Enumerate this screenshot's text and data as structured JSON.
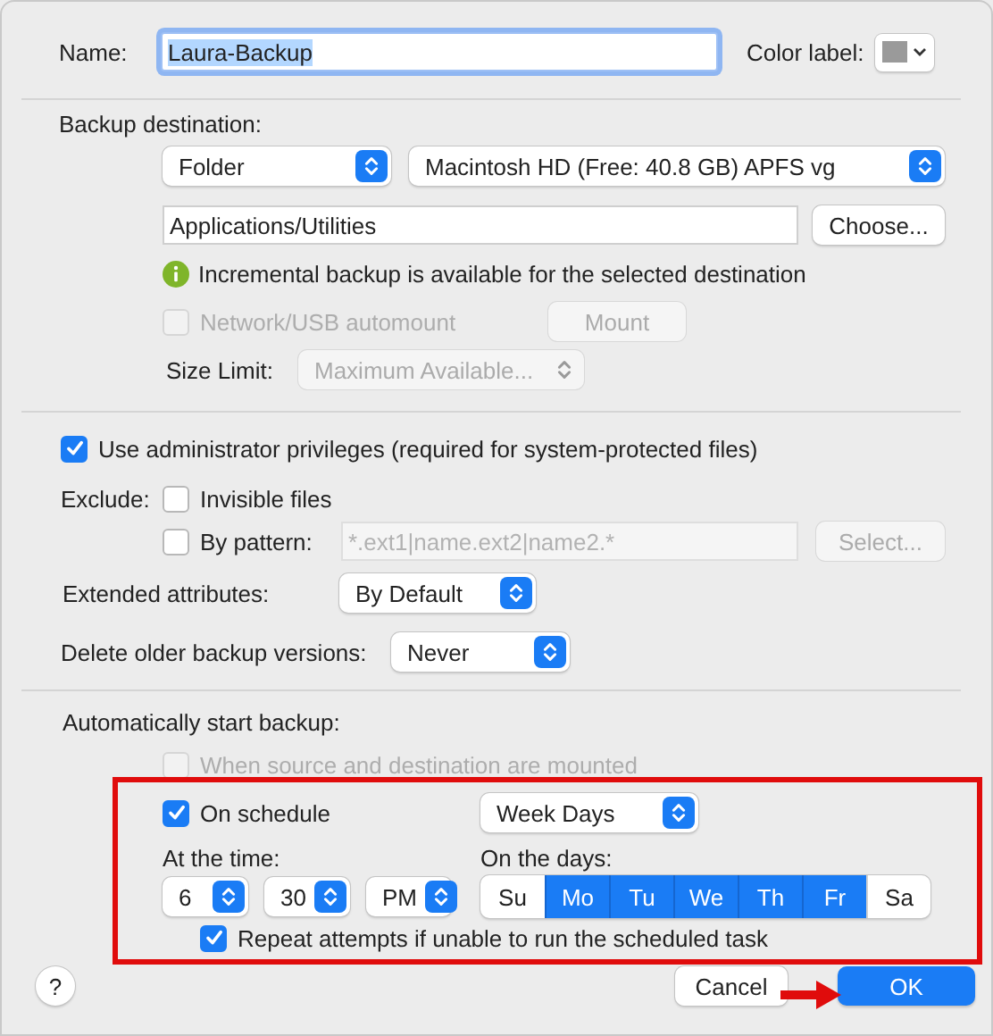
{
  "name_field": {
    "label": "Name:",
    "value": "Laura-Backup",
    "selected": true
  },
  "color_label": {
    "label": "Color label:"
  },
  "backup_destination": {
    "heading": "Backup destination:",
    "type_popup": {
      "value": "Folder"
    },
    "volume_popup": {
      "value": "Macintosh HD (Free: 40.8 GB) APFS vg"
    },
    "path_field": {
      "value": "Applications/Utilities"
    },
    "choose_button": {
      "label": "Choose..."
    },
    "info": "Incremental backup is available for the selected destination",
    "automount": {
      "label": "Network/USB automount",
      "checked": false,
      "disabled": true
    },
    "mount_button": {
      "label": "Mount",
      "disabled": true
    },
    "size_limit": {
      "label": "Size Limit:",
      "value": "Maximum Available...",
      "disabled": true
    }
  },
  "admin_privileges": {
    "label": "Use administrator privileges (required for system-protected files)",
    "checked": true
  },
  "exclude": {
    "label": "Exclude:",
    "invisible_files": {
      "label": "Invisible files",
      "checked": false
    },
    "by_pattern": {
      "label": "By pattern:",
      "checked": false
    },
    "pattern_field": {
      "placeholder": "*.ext1|name.ext2|name2.*",
      "disabled": true
    },
    "select_button": {
      "label": "Select...",
      "disabled": true
    }
  },
  "extended_attributes": {
    "label": "Extended attributes:",
    "value": "By Default"
  },
  "delete_older": {
    "label": "Delete older backup versions:",
    "value": "Never"
  },
  "auto_start": {
    "heading": "Automatically start backup:",
    "when_mounted": {
      "label": "When source and destination are mounted",
      "checked": false,
      "disabled": true
    },
    "on_schedule": {
      "label": "On schedule",
      "checked": true
    },
    "frequency": {
      "value": "Week Days"
    },
    "time": {
      "label": "At the time:",
      "hour": "6",
      "minute": "30",
      "period": "PM"
    },
    "days": {
      "label": "On the days:",
      "items": [
        {
          "label": "Su",
          "selected": false
        },
        {
          "label": "Mo",
          "selected": true
        },
        {
          "label": "Tu",
          "selected": true
        },
        {
          "label": "We",
          "selected": true
        },
        {
          "label": "Th",
          "selected": true
        },
        {
          "label": "Fr",
          "selected": true
        },
        {
          "label": "Sa",
          "selected": false
        }
      ]
    },
    "repeat": {
      "label": "Repeat attempts if unable to run the scheduled task",
      "checked": true
    }
  },
  "footer": {
    "help": "?",
    "cancel": {
      "label": "Cancel"
    },
    "ok": {
      "label": "OK",
      "kind": "default"
    }
  }
}
